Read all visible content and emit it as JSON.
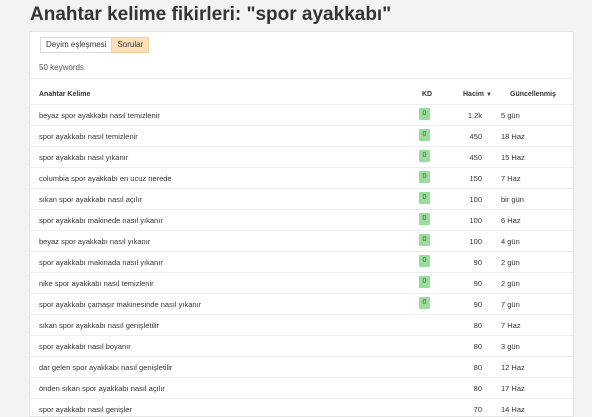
{
  "page_title": "Anahtar kelime fikirleri: \"spor ayakkabı\"",
  "tabs": [
    {
      "label": "Deyim eşleşmesi",
      "active": false
    },
    {
      "label": "Sorular",
      "active": true
    }
  ],
  "keyword_count": "50 keywords",
  "table": {
    "columns": {
      "keyword": "Anahtar Kelime",
      "kd": "KD",
      "volume": "Hacim",
      "updated": "Güncellenmiş"
    },
    "sort_indicator": "▼",
    "rows": [
      {
        "keyword": "beyaz spor ayakkabı nasıl temizlenir",
        "kd": "0",
        "volume": "1.2k",
        "updated": "5 gün"
      },
      {
        "keyword": "spor ayakkabı nasıl temizlenir",
        "kd": "0",
        "volume": "450",
        "updated": "18 Haz"
      },
      {
        "keyword": "spor ayakkabı nasıl yıkanır",
        "kd": "0",
        "volume": "450",
        "updated": "15 Haz"
      },
      {
        "keyword": "columbia spor ayakkabı en ucuz nerede",
        "kd": "0",
        "volume": "150",
        "updated": "7 Haz"
      },
      {
        "keyword": "sıkan spor ayakkabı nasıl açılır",
        "kd": "0",
        "volume": "100",
        "updated": "bir gün"
      },
      {
        "keyword": "spor ayakkabı makinede nasıl yıkanır",
        "kd": "0",
        "volume": "100",
        "updated": "6 Haz"
      },
      {
        "keyword": "beyaz spor ayakkabı nasıl yıkanır",
        "kd": "0",
        "volume": "100",
        "updated": "4 gün"
      },
      {
        "keyword": "spor ayakkabı makinada nasıl yıkanır",
        "kd": "0",
        "volume": "90",
        "updated": "2 gün"
      },
      {
        "keyword": "nike spor ayakkabı nasıl temizlenir",
        "kd": "0",
        "volume": "90",
        "updated": "2 gün"
      },
      {
        "keyword": "spor ayakkabı çamaşır makinesinde nasıl yıkanır",
        "kd": "0",
        "volume": "90",
        "updated": "7 gün"
      },
      {
        "keyword": "sıkan spor ayakkabı nasıl genişletilir",
        "kd": "",
        "volume": "80",
        "updated": "7 Haz"
      },
      {
        "keyword": "spor ayakkabı nasıl boyanır",
        "kd": "",
        "volume": "80",
        "updated": "3 gün"
      },
      {
        "keyword": "dar gelen spor ayakkabı nasıl genişletilir",
        "kd": "",
        "volume": "80",
        "updated": "12 Haz"
      },
      {
        "keyword": "önden sıkan spor ayakkabı nasıl açılır",
        "kd": "",
        "volume": "80",
        "updated": "17 Haz"
      },
      {
        "keyword": "spor ayakkabı nasıl genişler",
        "kd": "",
        "volume": "70",
        "updated": "14 Haz"
      }
    ]
  }
}
